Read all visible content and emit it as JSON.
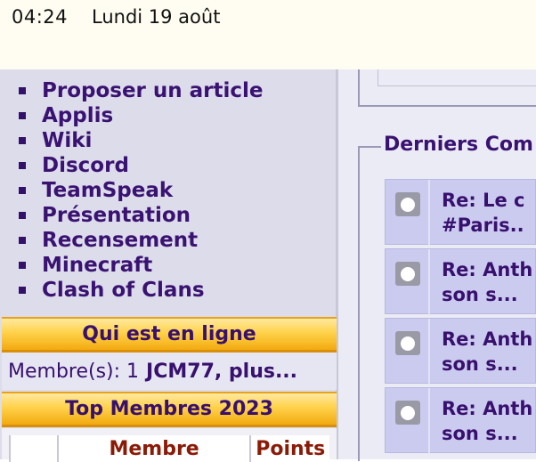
{
  "status_bar": {
    "time": "04:24",
    "date": "Lundi 19 août"
  },
  "menu": {
    "items": [
      {
        "label": "Proposer un article"
      },
      {
        "label": "Applis"
      },
      {
        "label": "Wiki"
      },
      {
        "label": "Discord"
      },
      {
        "label": "TeamSpeak"
      },
      {
        "label": "Présentation"
      },
      {
        "label": "Recensement"
      },
      {
        "label": "Minecraft"
      },
      {
        "label": "Clash of Clans"
      }
    ]
  },
  "online": {
    "title": "Qui est en ligne",
    "label": "Membre(s): 1",
    "names": "JCM77, plus..."
  },
  "top_members": {
    "title": "Top Membres 2023",
    "columns": [
      "",
      "Membre",
      "Points"
    ]
  },
  "comments": {
    "title": "Derniers Com",
    "items": [
      {
        "line1": "Re: Le c",
        "line2": "#Paris.."
      },
      {
        "line1": "Re: Anth",
        "line2": "son s..."
      },
      {
        "line1": "Re: Anth",
        "line2": "son s..."
      },
      {
        "line1": "Re: Anth",
        "line2": "son s..."
      }
    ]
  },
  "colors": {
    "link": "#3a1272",
    "header_gold": "#ffd24a",
    "points_header": "#8b1a06"
  }
}
